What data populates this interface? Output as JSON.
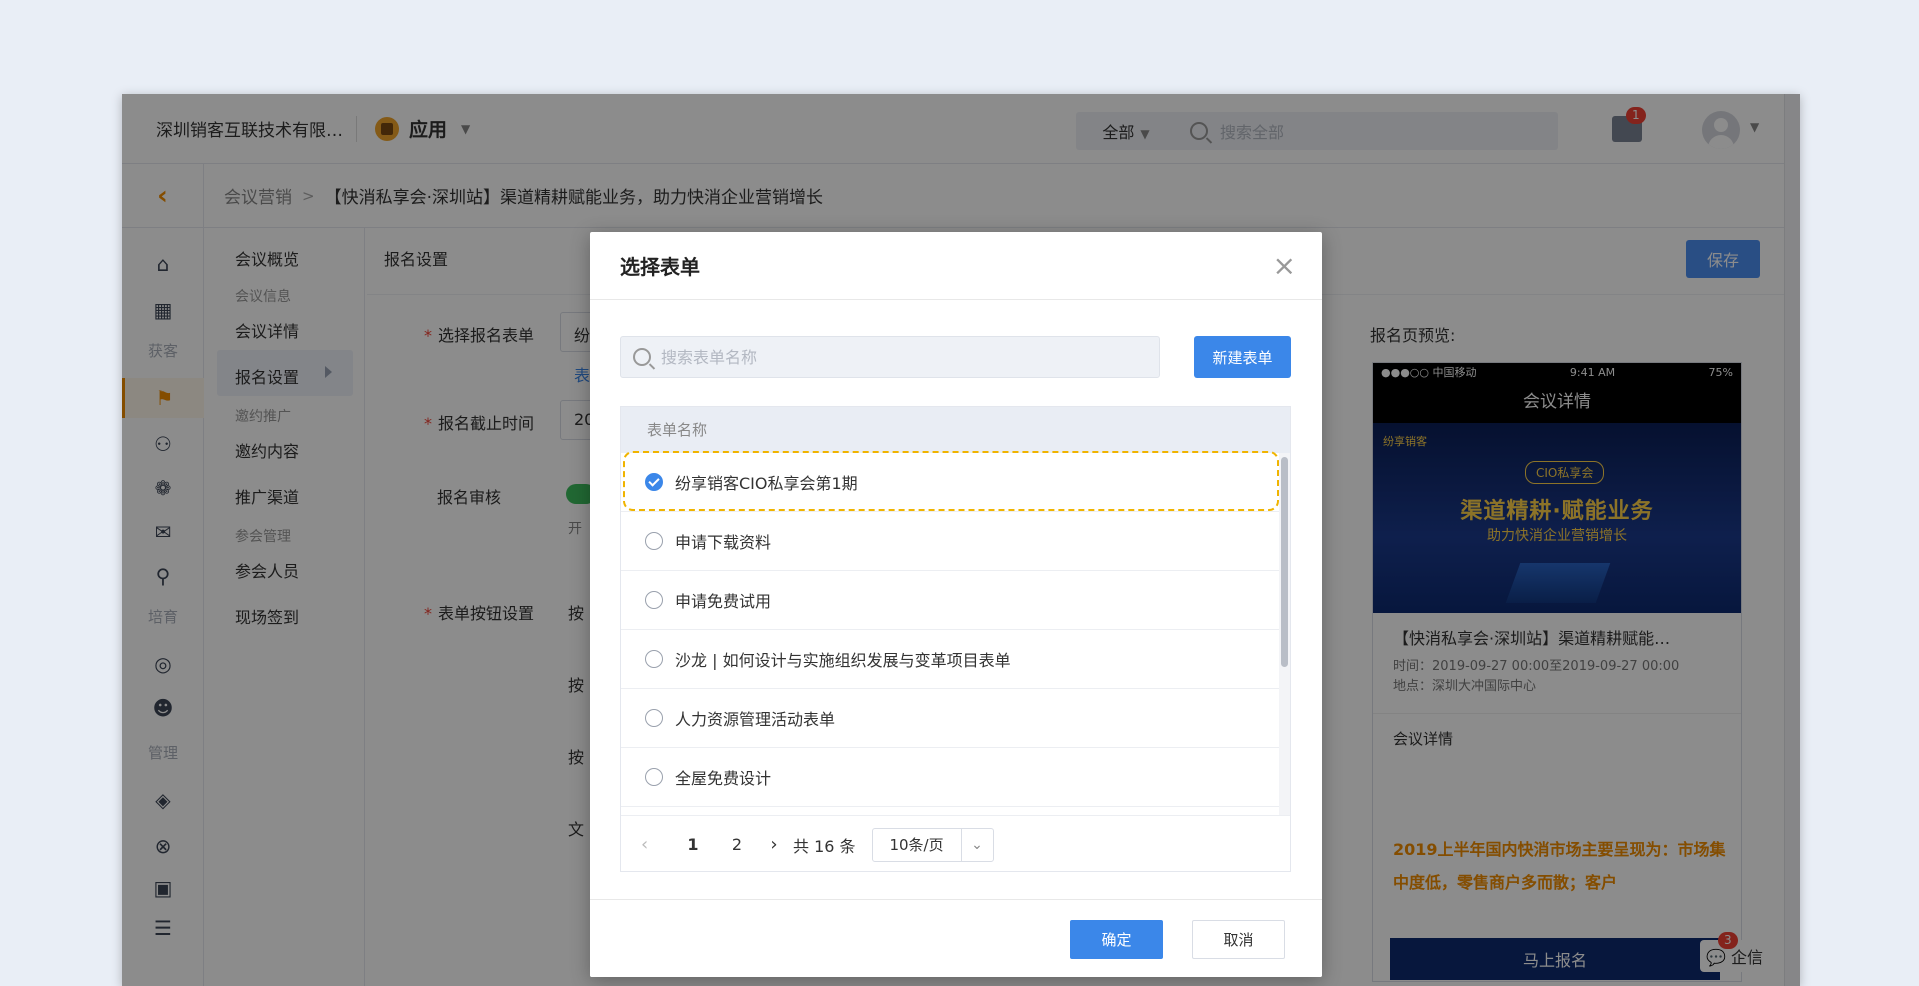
{
  "header": {
    "company": "深圳销客互联技术有限…",
    "app_label": "应用",
    "search_scope": "全部",
    "search_placeholder": "搜索全部",
    "mail_badge": "1"
  },
  "breadcrumb": {
    "back_glyph": "‹",
    "parent": "会议营销",
    "current": "【快消私享会·深圳站】渠道精耕赋能业务，助力快消企业营销增长"
  },
  "iconbar": {
    "group_1": "获客",
    "group_2": "培育",
    "group_3": "管理"
  },
  "subnav": {
    "items": [
      {
        "label": "会议概览",
        "muted": false
      },
      {
        "label": "会议信息",
        "muted": true
      },
      {
        "label": "会议详情",
        "muted": false
      },
      {
        "label": "报名设置",
        "muted": false
      },
      {
        "label": "邀约推广",
        "muted": true
      },
      {
        "label": "邀约内容",
        "muted": false
      },
      {
        "label": "推广渠道",
        "muted": false
      },
      {
        "label": "参会管理",
        "muted": true
      },
      {
        "label": "参会人员",
        "muted": false
      },
      {
        "label": "现场签到",
        "muted": false
      }
    ]
  },
  "main": {
    "title": "报名设置",
    "save_label": "保存",
    "labels": {
      "form": "选择报名表单",
      "deadline": "报名截止时间",
      "review": "报名审核",
      "button_settings": "表单按钮设置"
    },
    "fragments": {
      "form_value": "纷",
      "form_link": "表",
      "deadline_value": "20",
      "review_hint": "开",
      "btn1": "按",
      "btn2": "按",
      "btn3": "按",
      "text": "文"
    }
  },
  "preview": {
    "title": "报名页预览:",
    "status_left": "●●●○○ 中国移动",
    "status_time": "9:41 AM",
    "status_right": "75%",
    "nav_title": "会议详情",
    "banner_brand": "纷享销客",
    "banner_cio": "CIO私享会",
    "banner_title": "渠道精耕·赋能业务",
    "banner_subtitle": "助力快消企业营销增长",
    "event_title": "【快消私享会·深圳站】渠道精耕赋能…",
    "time": "时间：2019-09-27 00:00至2019-09-27 00:00",
    "location": "地点：深圳大冲国际中心",
    "section": "会议详情",
    "highlight": "2019上半年国内快消市场主要呈现为：市场集中度低，零售商户多而散；客户",
    "signup_button": "马上报名",
    "qiyin_label": "企信",
    "qiyin_badge": "3"
  },
  "modal": {
    "title": "选择表单",
    "close_glyph": "×",
    "search_placeholder": "搜索表单名称",
    "new_button": "新建表单",
    "column_header": "表单名称",
    "rows": [
      {
        "label": "纷享销客CIO私享会第1期",
        "checked": true
      },
      {
        "label": "申请下载资料",
        "checked": false
      },
      {
        "label": "申请免费试用",
        "checked": false
      },
      {
        "label": "沙龙 | 如何设计与实施组织发展与变革项目表单",
        "checked": false
      },
      {
        "label": "人力资源管理活动表单",
        "checked": false
      },
      {
        "label": "全屋免费设计",
        "checked": false
      }
    ],
    "pager": {
      "prev": "‹",
      "pages": [
        "1",
        "2"
      ],
      "current_page": "1",
      "next": "›",
      "total": "共 16 条",
      "page_size": "10条/页"
    },
    "ok_label": "确定",
    "cancel_label": "取消"
  },
  "colors": {
    "primary": "#3b87e9",
    "accent_orange": "#f08c00",
    "selection_ring": "#f0b400",
    "badge_red": "#f04134"
  }
}
